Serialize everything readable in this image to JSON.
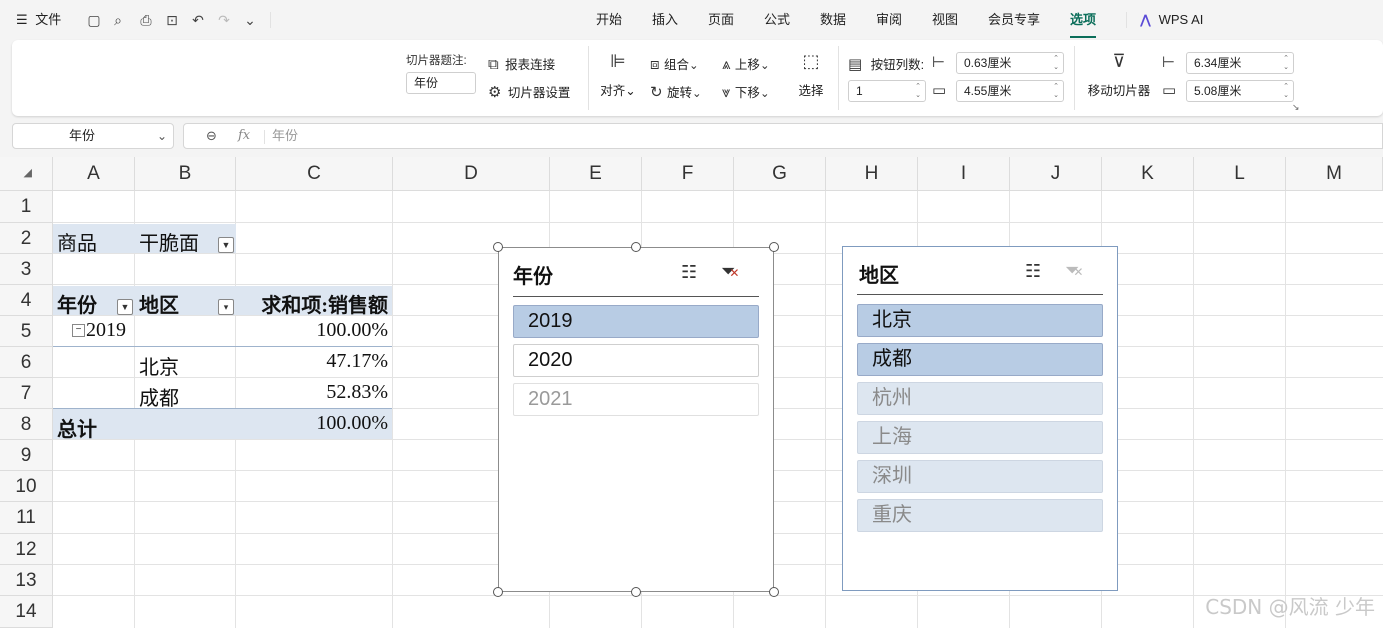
{
  "menubar": {
    "file_label": "文件",
    "tabs": [
      "开始",
      "插入",
      "页面",
      "公式",
      "数据",
      "审阅",
      "视图",
      "会员专享",
      "选项"
    ],
    "active_tab": "选项",
    "wps_ai": "WPS AI"
  },
  "ribbon": {
    "caption_label": "切片器题注:",
    "caption_value": "年份",
    "report_connections": "报表连接",
    "slicer_settings": "切片器设置",
    "align": "对齐",
    "group": "组合",
    "rotate": "旋转",
    "bring_forward": "上移",
    "send_backward": "下移",
    "select": "选择",
    "button_columns_label": "按钮列数:",
    "button_columns_value": "1",
    "button_width": "0.63厘米",
    "button_height": "4.55厘米",
    "move_slicer": "移动切片器",
    "slicer_width": "6.34厘米",
    "slicer_height": "5.08厘米"
  },
  "formula": {
    "namebox": "年份",
    "fx": "fx",
    "content": "年份"
  },
  "sheet": {
    "columns": [
      "A",
      "B",
      "C",
      "D",
      "E",
      "F",
      "G",
      "H",
      "I",
      "J",
      "K",
      "L",
      "M"
    ],
    "rows": [
      "1",
      "2",
      "3",
      "4",
      "5",
      "6",
      "7",
      "8",
      "9",
      "10",
      "11",
      "12",
      "13",
      "14"
    ],
    "pivot": {
      "filter_label": "商品",
      "filter_value": "干脆面",
      "row_header_1": "年份",
      "row_header_2": "地区",
      "value_header": "求和项:销售额",
      "year": "2019",
      "year_total": "100.00%",
      "region_1": "北京",
      "region_1_value": "47.17%",
      "region_2": "成都",
      "region_2_value": "52.83%",
      "grand_total_label": "总计",
      "grand_total_value": "100.00%"
    }
  },
  "slicer_year": {
    "title": "年份",
    "items": [
      "2019",
      "2020",
      "2021"
    ]
  },
  "slicer_region": {
    "title": "地区",
    "items": [
      "北京",
      "成都",
      "杭州",
      "上海",
      "深圳",
      "重庆"
    ]
  },
  "watermark": "CSDN @风流 少年",
  "colors": {
    "accent": "#0b6e5a",
    "slicer_selected": "#b8cce4",
    "pivot_band": "#dde6f1"
  }
}
